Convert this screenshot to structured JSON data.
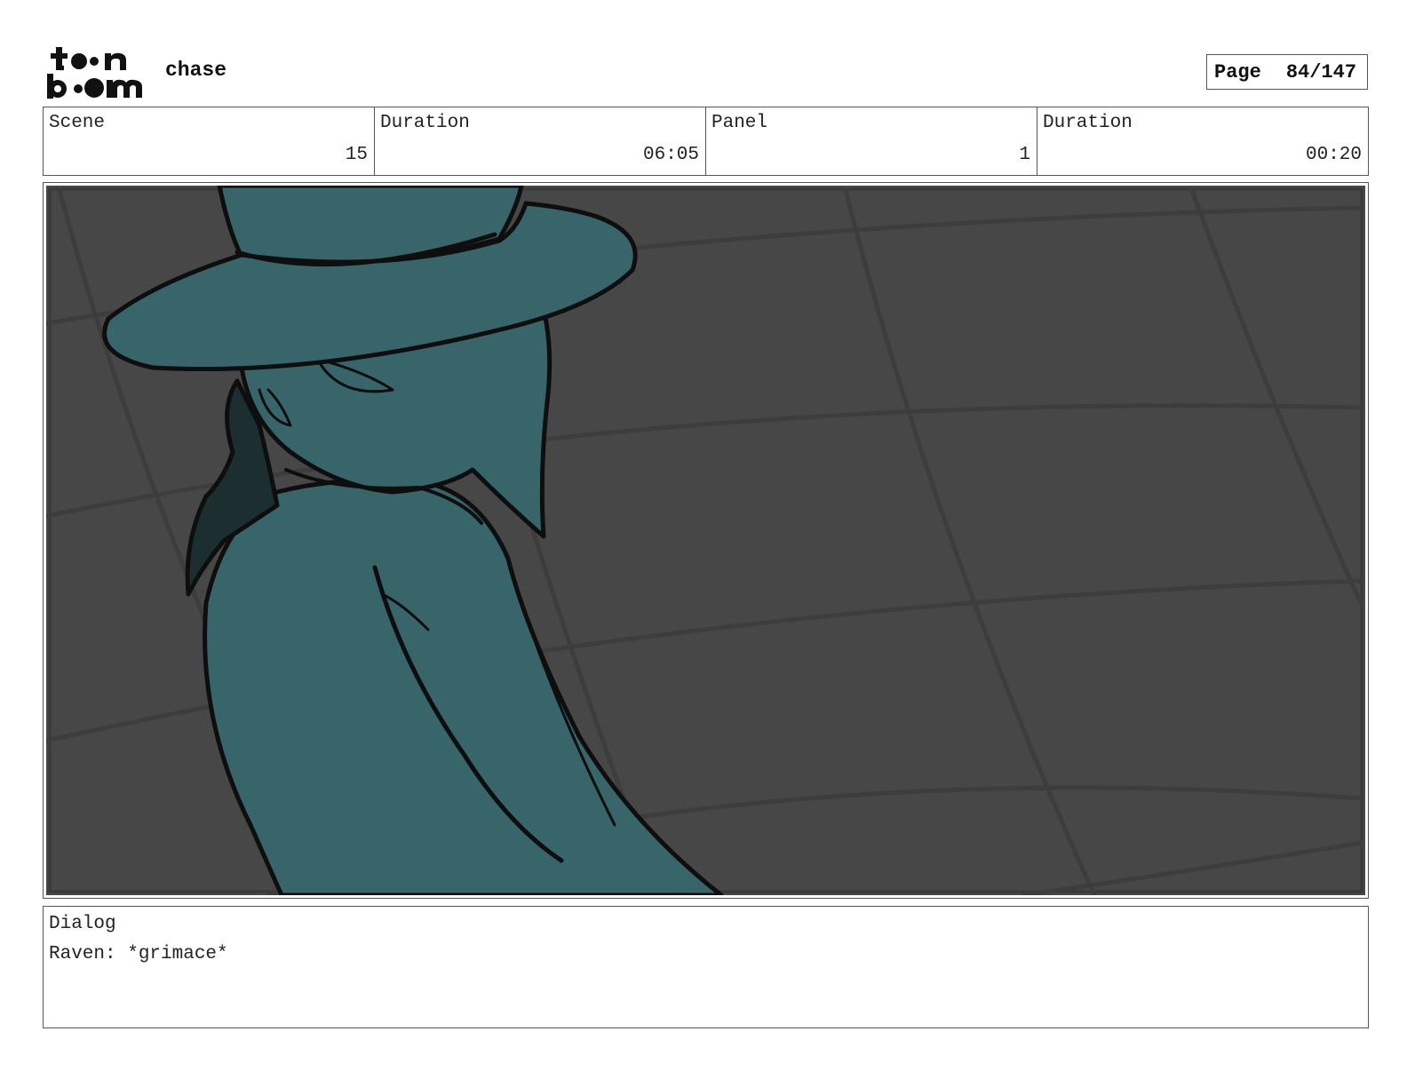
{
  "header": {
    "logo_name": "toonboom-logo",
    "project_title": "chase",
    "page_label": "Page",
    "page_number": "84/147"
  },
  "info": {
    "scene_label": "Scene",
    "scene_value": "15",
    "scene_duration_label": "Duration",
    "scene_duration_value": "06:05",
    "panel_label": "Panel",
    "panel_value": "1",
    "panel_duration_label": "Duration",
    "panel_duration_value": "00:20"
  },
  "panel": {
    "description": "",
    "background_color": "#474747",
    "figure_color": "#37656a",
    "line_color": "#0e0e0e"
  },
  "dialog": {
    "label": "Dialog",
    "text": "Raven: *grimace*"
  }
}
